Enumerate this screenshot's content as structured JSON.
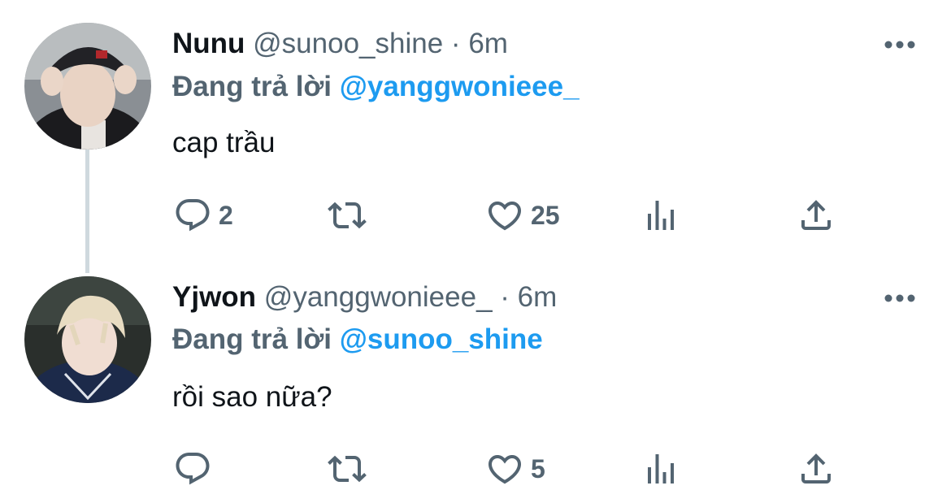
{
  "tweets": [
    {
      "name": "Nunu",
      "handle": "@sunoo_shine",
      "separator": "·",
      "time": "6m",
      "reply_prefix": "Đang trả lời",
      "reply_to": "@yanggwonieee_",
      "text": "cap trầu",
      "replies": "2",
      "likes": "25"
    },
    {
      "name": "Yjwon",
      "handle": "@yanggwonieee_",
      "separator": "·",
      "time": "6m",
      "reply_prefix": "Đang trả lời",
      "reply_to": "@sunoo_shine",
      "text": "rồi sao nữa?",
      "replies": "",
      "likes": "5"
    }
  ],
  "colors": {
    "text": "#0f1419",
    "secondary": "#536471",
    "accent": "#1d9bf0",
    "thread_line": "#cfd9de"
  },
  "icons": [
    "more-icon",
    "reply-icon",
    "retweet-icon",
    "like-icon",
    "analytics-icon",
    "share-icon"
  ]
}
